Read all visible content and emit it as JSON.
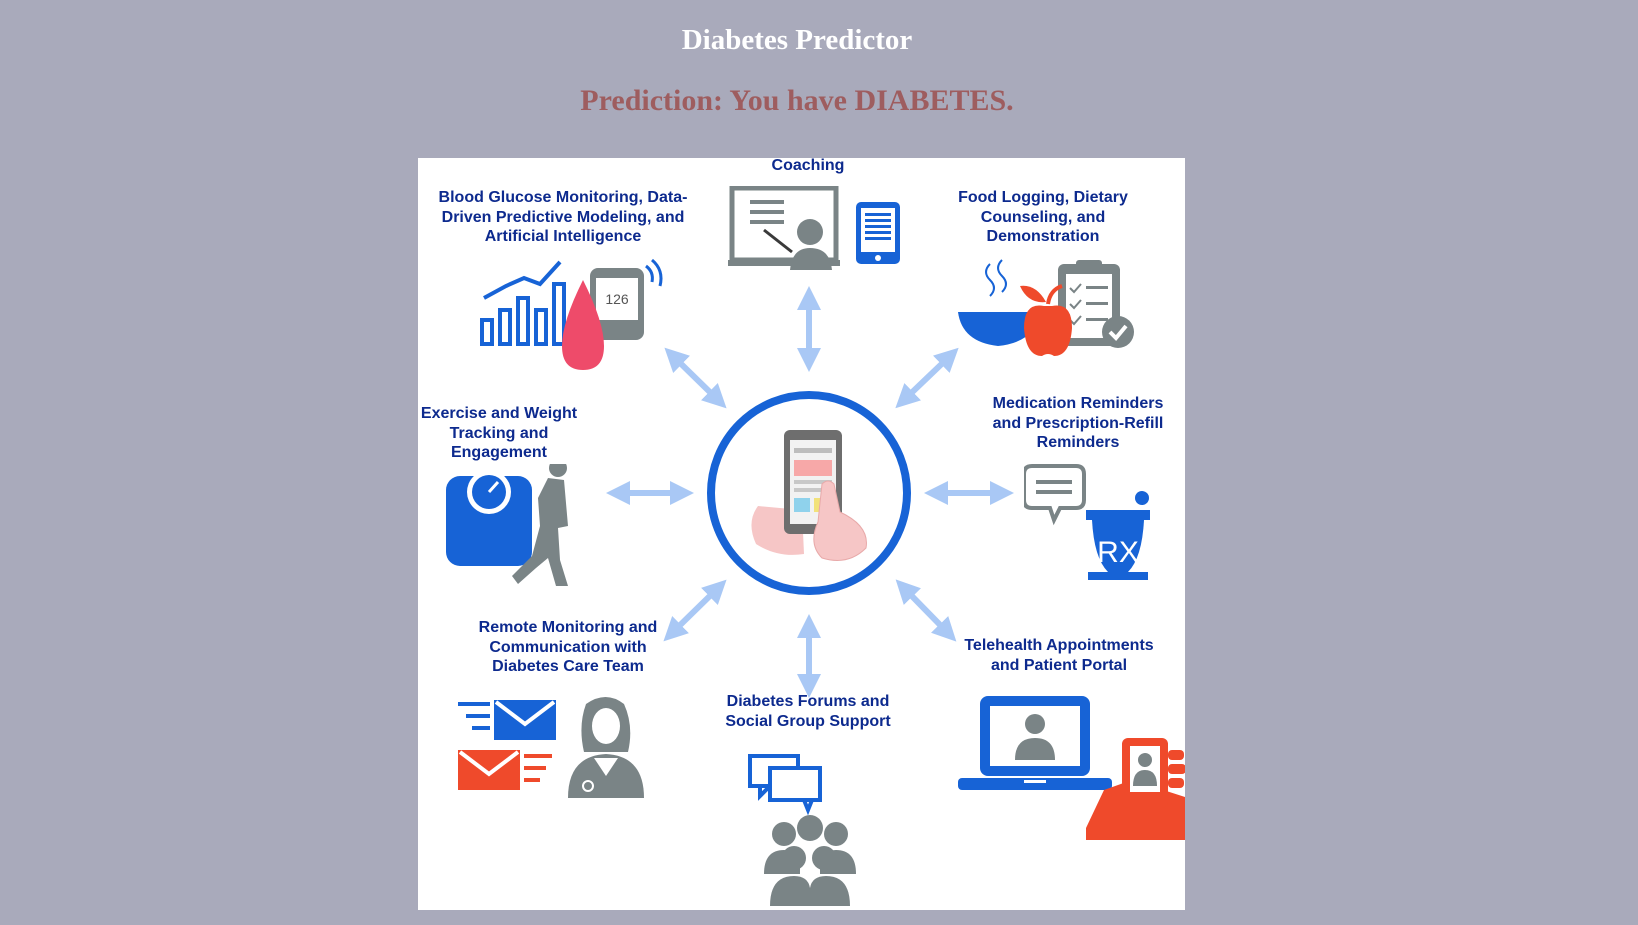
{
  "page": {
    "title": "Diabetes Predictor",
    "prediction": "Prediction: You have DIABETES."
  },
  "infographic": {
    "labels": {
      "coaching": [
        "Coaching"
      ],
      "glucose": [
        "Blood Glucose Monitoring, Data-",
        "Driven Predictive Modeling, and",
        "Artificial Intelligence"
      ],
      "food": [
        "Food Logging, Dietary",
        "Counseling, and",
        "Demonstration"
      ],
      "exercise": [
        "Exercise and Weight",
        "Tracking and",
        "Engagement"
      ],
      "medication": [
        "Medication Reminders",
        "and Prescription-Refill",
        "Reminders"
      ],
      "remote": [
        "Remote Monitoring and",
        "Communication with",
        "Diabetes Care Team"
      ],
      "forums": [
        "Diabetes Forums and",
        "Social Group Support"
      ],
      "telehealth": [
        "Telehealth Appointments",
        "and Patient Portal"
      ]
    },
    "glucose_reading": "126",
    "rx_text": "RX"
  },
  "colors": {
    "background": "#a9aabb",
    "title": "#ffffff",
    "prediction": "#9e5d5f",
    "label_text": "#0d2a8e",
    "accent_blue": "#1763d6",
    "arrow_blue": "#a9c8f5",
    "icon_gray": "#7a8486",
    "accent_red": "#ef4a2b",
    "drop_pink": "#ee4b6a"
  },
  "icons": [
    "coaching-board-icon",
    "tablet-icon",
    "chart-icon",
    "blood-drop-icon",
    "glucose-meter-icon",
    "food-bowl-icon",
    "apple-icon",
    "clipboard-icon",
    "scale-icon",
    "runner-icon",
    "phone-hands-icon",
    "chat-bubble-icon",
    "mortar-rx-icon",
    "envelope-icon",
    "doctor-icon",
    "chat-bubbles-icon",
    "group-icon",
    "laptop-icon",
    "handheld-phone-icon"
  ]
}
